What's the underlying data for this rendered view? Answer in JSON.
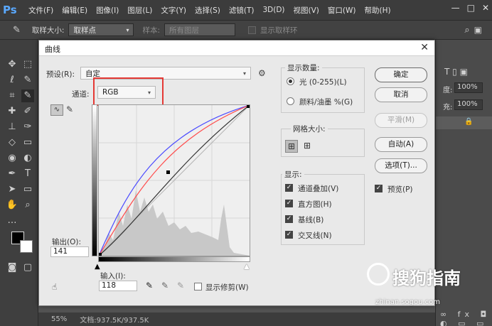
{
  "app": {
    "logo": "Ps",
    "menu": [
      "文件(F)",
      "编辑(E)",
      "图像(I)",
      "图层(L)",
      "文字(Y)",
      "选择(S)",
      "滤镜(T)",
      "3D(D)",
      "视图(V)",
      "窗口(W)",
      "帮助(H)"
    ]
  },
  "options_bar": {
    "sample_size_label": "取样大小:",
    "sample_size_value": "取样点",
    "sample_label": "样本:",
    "sample_value": "所有图层",
    "show_ring_label": "显示取样环"
  },
  "status": {
    "zoom": "55%",
    "doc": "文档:937.5K/937.5K"
  },
  "dialog": {
    "title": "曲线",
    "preset_label": "预设(R):",
    "preset_value": "自定",
    "channel_label": "通道:",
    "channel_value": "RGB",
    "output_label": "输出(O):",
    "output_value": "141",
    "input_label": "输入(I):",
    "input_value": "118",
    "show_clipping_label": "显示修剪(W)",
    "show_amount": {
      "title": "显示数量:",
      "light": "光 (0-255)(L)",
      "pigment": "颜料/油墨 %(G)"
    },
    "grid_size_title": "网格大小:",
    "show": {
      "title": "显示:",
      "items": [
        {
          "label": "通道叠加(V)",
          "checked": true
        },
        {
          "label": "直方图(H)",
          "checked": true
        },
        {
          "label": "基线(B)",
          "checked": true
        },
        {
          "label": "交叉线(N)",
          "checked": true
        }
      ]
    },
    "buttons": {
      "ok": "确定",
      "cancel": "取消",
      "smooth": "平滑(M)",
      "auto": "自动(A)",
      "options": "选项(T)..."
    },
    "preview_label": "预览(P)"
  },
  "right_panel": {
    "opacity_label": "度:",
    "opacity_value": "100%",
    "fill_label": "充:",
    "fill_value": "100%"
  },
  "watermark": {
    "title": "搜狗指南",
    "url": "zhinan.sogou.com"
  }
}
